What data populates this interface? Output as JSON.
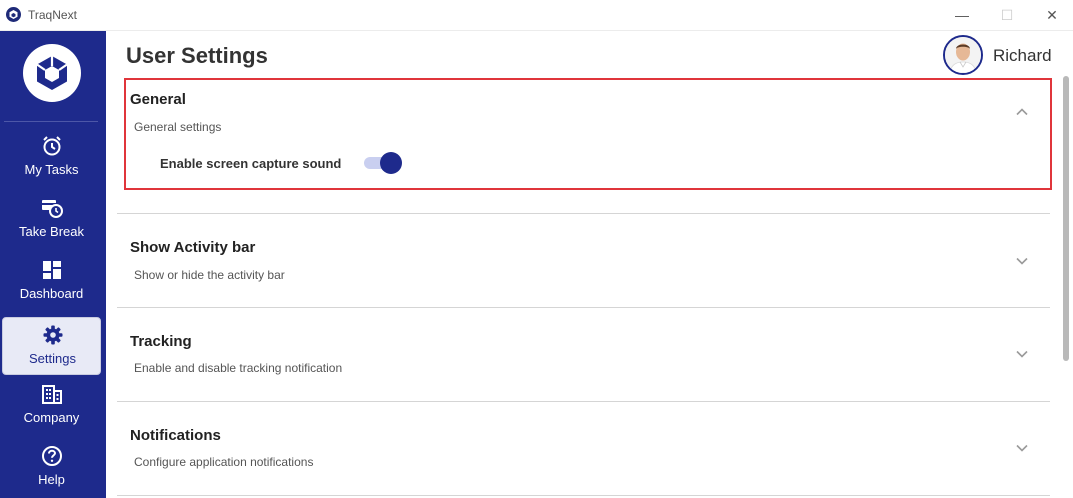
{
  "window": {
    "title": "TraqNext",
    "controls": {
      "minimize": "—",
      "maximize": "☐",
      "close": "✕"
    }
  },
  "sidebar": {
    "items": [
      {
        "label": "My Tasks",
        "icon": "alarm-clock-icon",
        "active": false
      },
      {
        "label": "Take Break",
        "icon": "break-icon",
        "active": false
      },
      {
        "label": "Dashboard",
        "icon": "dashboard-icon",
        "active": false
      },
      {
        "label": "Settings",
        "icon": "gear-icon",
        "active": true
      },
      {
        "label": "Company",
        "icon": "building-icon",
        "active": false
      },
      {
        "label": "Help",
        "icon": "help-icon",
        "active": false
      }
    ]
  },
  "header": {
    "title": "User Settings",
    "user_name": "Richard"
  },
  "sections": [
    {
      "title": "General",
      "subtitle": "General settings",
      "expanded": true,
      "toggle": {
        "label": "Enable screen capture sound",
        "on": true
      }
    },
    {
      "title": "Show Activity bar",
      "subtitle": "Show or hide the activity bar",
      "expanded": false
    },
    {
      "title": "Tracking",
      "subtitle": "Enable and disable tracking notification",
      "expanded": false
    },
    {
      "title": "Notifications",
      "subtitle": "Configure application notifications",
      "expanded": false
    }
  ],
  "colors": {
    "brand": "#1e2a8c",
    "highlight": "#e0353b",
    "toggle_track": "#c9cff0"
  }
}
